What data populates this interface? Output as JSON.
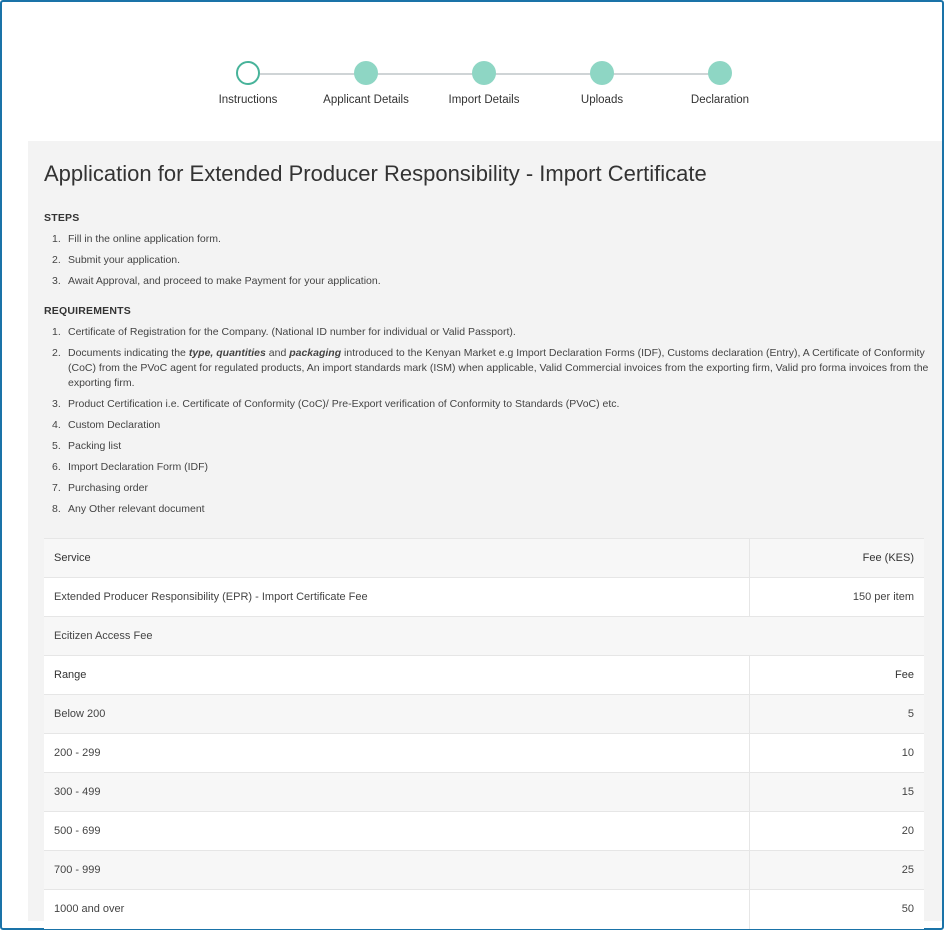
{
  "stepper": {
    "steps": [
      {
        "label": "Instructions",
        "state": "current"
      },
      {
        "label": "Applicant Details",
        "state": "pending"
      },
      {
        "label": "Import Details",
        "state": "pending"
      },
      {
        "label": "Uploads",
        "state": "pending"
      },
      {
        "label": "Declaration",
        "state": "pending"
      }
    ]
  },
  "page": {
    "title": "Application for Extended Producer Responsibility - Import Certificate"
  },
  "steps_section": {
    "heading": "STEPS",
    "items": [
      {
        "num": "1.",
        "text": "Fill in the online application form."
      },
      {
        "num": "2.",
        "text": "Submit your application."
      },
      {
        "num": "3.",
        "text": "Await Approval, and proceed to make Payment for your application."
      }
    ]
  },
  "requirements_section": {
    "heading": "REQUIREMENTS",
    "items": [
      {
        "num": "1.",
        "text": "Certificate of Registration for the Company. (National ID number for individual or Valid Passport)."
      },
      {
        "num": "2.",
        "text_a": "Documents indicating the ",
        "em1": "type, quantities",
        "text_b": " and ",
        "em2": "packaging",
        "text_c": " introduced to the Kenyan Market e.g Import Declaration Forms (IDF), Customs declaration (Entry), A Certificate of Conformity (CoC) from the PVoC agent for regulated products, An import standards mark (ISM) when applicable, Valid Commercial invoices from the exporting firm, Valid pro forma invoices from the exporting firm."
      },
      {
        "num": "3.",
        "text": "Product Certification i.e. Certificate of Conformity (CoC)/ Pre-Export verification of Conformity to Standards (PVoC) etc."
      },
      {
        "num": "4.",
        "text": "Custom Declaration"
      },
      {
        "num": "5.",
        "text": "Packing list"
      },
      {
        "num": "6.",
        "text": "Import Declaration Form (IDF)"
      },
      {
        "num": "7.",
        "text": "Purchasing order"
      },
      {
        "num": "8.",
        "text": "Any Other relevant document"
      }
    ]
  },
  "fee_table": {
    "service_header": "Service",
    "fee_header": "Fee (KES)",
    "service_row": {
      "name": "Extended Producer Responsibility (EPR) - Import Certificate Fee",
      "fee": "150 per item"
    },
    "ecitizen_label": "Ecitizen Access Fee",
    "range_header": "Range",
    "range_fee_header": "Fee",
    "ranges": [
      {
        "range": "Below 200",
        "fee": "5"
      },
      {
        "range": "200 - 299",
        "fee": "10"
      },
      {
        "range": "300 - 499",
        "fee": "15"
      },
      {
        "range": "500 - 699",
        "fee": "20"
      },
      {
        "range": "700 - 999",
        "fee": "25"
      },
      {
        "range": "1000 and over",
        "fee": "50"
      }
    ]
  }
}
